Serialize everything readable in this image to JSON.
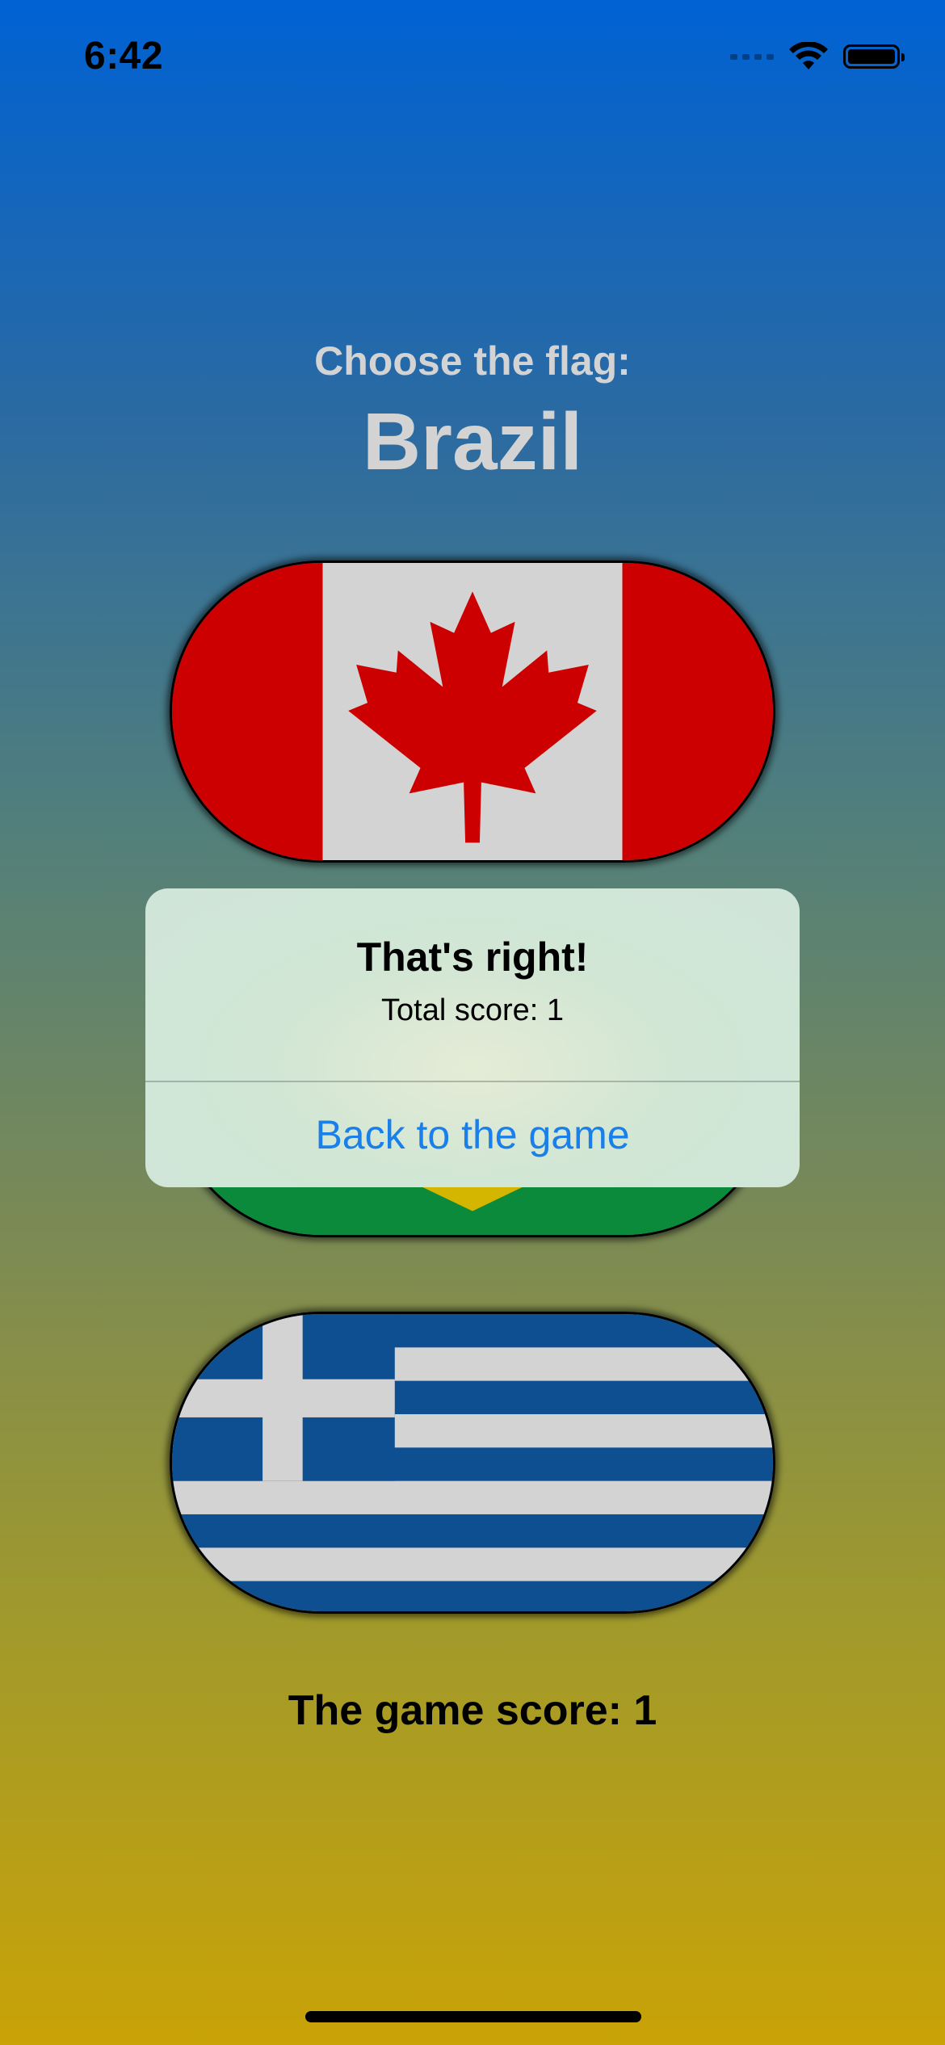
{
  "status_bar": {
    "time": "6:42",
    "icons": [
      "cellular-signal-icon",
      "wifi-icon",
      "battery-icon"
    ]
  },
  "game": {
    "prompt": "Choose the flag:",
    "country": "Brazil",
    "flags": [
      {
        "name": "Canada",
        "icon": "canada-flag"
      },
      {
        "name": "Brazil",
        "icon": "brazil-flag"
      },
      {
        "name": "Greece",
        "icon": "greece-flag"
      }
    ],
    "score_text": "The game score: 1"
  },
  "alert": {
    "title": "That's right!",
    "message": "Total score: 1",
    "action_label": "Back to the game"
  },
  "colors": {
    "gradient_top": "#0062d3",
    "gradient_bottom": "#c9a307",
    "accent_link": "#1a7fe8"
  }
}
